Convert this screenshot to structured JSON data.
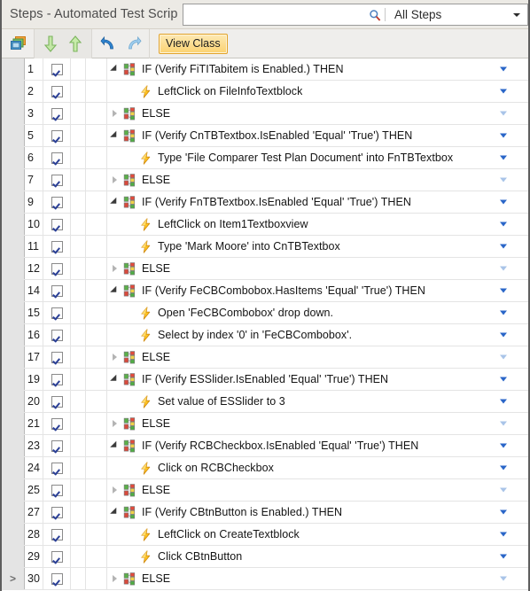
{
  "window": {
    "title": "Steps - Automated Test Scrip"
  },
  "search": {
    "value": "",
    "placeholder": "",
    "icon": "search-icon",
    "scope_label": "All Steps",
    "scope_options": [
      "All Steps"
    ]
  },
  "toolbar": {
    "buttons": [
      {
        "name": "copy-steps-icon",
        "glyph": "windows-stack",
        "label": ""
      },
      {
        "name": "move-down-icon",
        "glyph": "arrow-down",
        "label": ""
      },
      {
        "name": "move-up-icon",
        "glyph": "arrow-up",
        "label": ""
      },
      {
        "name": "undo-icon",
        "glyph": "undo",
        "label": ""
      },
      {
        "name": "redo-icon",
        "glyph": "redo",
        "label": ""
      }
    ],
    "view_class_label": "View Class"
  },
  "colors": {
    "accent_caret": "#2a66c8",
    "accent_caret_dim": "#a9c4e8",
    "checkbox_check": "#2a3f96",
    "highlight_button_bg": "#fbd271",
    "highlight_button_border": "#e2a32b",
    "titlebar_bg": "#eceae5",
    "toolbar_bg": "#efeeec",
    "row_header_bg": "#e4e4e4",
    "grid_line": "#e4e4e4"
  },
  "grid": {
    "rows": [
      {
        "num": "1",
        "checked": true,
        "expander": "open",
        "icon": "condition-icon",
        "indent": 0,
        "label": "IF (Verify FiTITabitem is Enabled.) THEN",
        "caret": "active",
        "current": false
      },
      {
        "num": "2",
        "checked": true,
        "expander": "none",
        "icon": "action-icon",
        "indent": 1,
        "label": "LeftClick on FileInfoTextblock",
        "caret": "active",
        "current": false
      },
      {
        "num": "3",
        "checked": true,
        "expander": "closed",
        "icon": "condition-icon",
        "indent": 0,
        "label": "ELSE",
        "caret": "dim",
        "current": false
      },
      {
        "num": "5",
        "checked": true,
        "expander": "open",
        "icon": "condition-icon",
        "indent": 0,
        "label": "IF (Verify CnTBTextbox.IsEnabled 'Equal' 'True') THEN",
        "caret": "active",
        "current": false
      },
      {
        "num": "6",
        "checked": true,
        "expander": "none",
        "icon": "action-icon",
        "indent": 1,
        "label": "Type 'File Comparer Test Plan Document' into FnTBTextbox",
        "caret": "active",
        "current": false
      },
      {
        "num": "7",
        "checked": true,
        "expander": "closed",
        "icon": "condition-icon",
        "indent": 0,
        "label": "ELSE",
        "caret": "dim",
        "current": false
      },
      {
        "num": "9",
        "checked": true,
        "expander": "open",
        "icon": "condition-icon",
        "indent": 0,
        "label": "IF (Verify FnTBTextbox.IsEnabled 'Equal' 'True') THEN",
        "caret": "active",
        "current": false
      },
      {
        "num": "10",
        "checked": true,
        "expander": "none",
        "icon": "action-icon",
        "indent": 1,
        "label": "LeftClick on Item1Textboxview",
        "caret": "active",
        "current": false
      },
      {
        "num": "11",
        "checked": true,
        "expander": "none",
        "icon": "action-icon",
        "indent": 1,
        "label": "Type 'Mark Moore' into CnTBTextbox",
        "caret": "active",
        "current": false
      },
      {
        "num": "12",
        "checked": true,
        "expander": "closed",
        "icon": "condition-icon",
        "indent": 0,
        "label": "ELSE",
        "caret": "dim",
        "current": false
      },
      {
        "num": "14",
        "checked": true,
        "expander": "open",
        "icon": "condition-icon",
        "indent": 0,
        "label": "IF (Verify FeCBCombobox.HasItems 'Equal' 'True') THEN",
        "caret": "active",
        "current": false
      },
      {
        "num": "15",
        "checked": true,
        "expander": "none",
        "icon": "action-icon",
        "indent": 1,
        "label": "Open 'FeCBCombobox' drop down.",
        "caret": "active",
        "current": false
      },
      {
        "num": "16",
        "checked": true,
        "expander": "none",
        "icon": "action-icon",
        "indent": 1,
        "label": "Select by index '0' in 'FeCBCombobox'.",
        "caret": "active",
        "current": false
      },
      {
        "num": "17",
        "checked": true,
        "expander": "closed",
        "icon": "condition-icon",
        "indent": 0,
        "label": "ELSE",
        "caret": "dim",
        "current": false
      },
      {
        "num": "19",
        "checked": true,
        "expander": "open",
        "icon": "condition-icon",
        "indent": 0,
        "label": "IF (Verify ESSlider.IsEnabled 'Equal' 'True') THEN",
        "caret": "active",
        "current": false
      },
      {
        "num": "20",
        "checked": true,
        "expander": "none",
        "icon": "action-icon",
        "indent": 1,
        "label": "Set value of ESSlider to 3",
        "caret": "active",
        "current": false
      },
      {
        "num": "21",
        "checked": true,
        "expander": "closed",
        "icon": "condition-icon",
        "indent": 0,
        "label": "ELSE",
        "caret": "dim",
        "current": false
      },
      {
        "num": "23",
        "checked": true,
        "expander": "open",
        "icon": "condition-icon",
        "indent": 0,
        "label": "IF (Verify RCBCheckbox.IsEnabled 'Equal' 'True') THEN",
        "caret": "active",
        "current": false
      },
      {
        "num": "24",
        "checked": true,
        "expander": "none",
        "icon": "action-icon",
        "indent": 1,
        "label": "Click on RCBCheckbox",
        "caret": "active",
        "current": false
      },
      {
        "num": "25",
        "checked": true,
        "expander": "closed",
        "icon": "condition-icon",
        "indent": 0,
        "label": "ELSE",
        "caret": "dim",
        "current": false
      },
      {
        "num": "27",
        "checked": true,
        "expander": "open",
        "icon": "condition-icon",
        "indent": 0,
        "label": "IF (Verify CBtnButton is Enabled.) THEN",
        "caret": "active",
        "current": false
      },
      {
        "num": "28",
        "checked": true,
        "expander": "none",
        "icon": "action-icon",
        "indent": 1,
        "label": "LeftClick on CreateTextblock",
        "caret": "active",
        "current": false
      },
      {
        "num": "29",
        "checked": true,
        "expander": "none",
        "icon": "action-icon",
        "indent": 1,
        "label": "Click CBtnButton",
        "caret": "active",
        "current": false
      },
      {
        "num": "30",
        "checked": true,
        "expander": "closed",
        "icon": "condition-icon",
        "indent": 0,
        "label": "ELSE",
        "caret": "dim",
        "current": true,
        "current_glyph": ">"
      }
    ]
  }
}
